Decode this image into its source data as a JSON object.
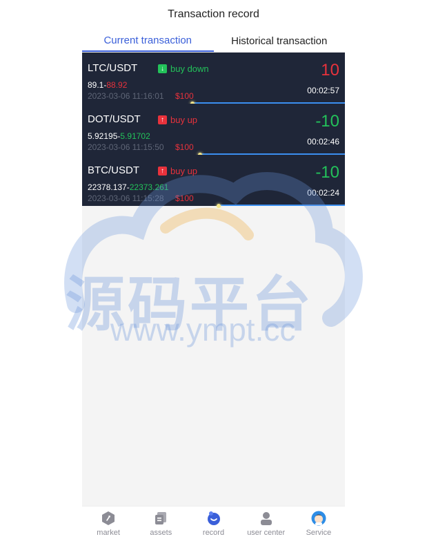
{
  "header": {
    "title": "Transaction record"
  },
  "tabs": [
    {
      "label": "Current transaction",
      "active": true
    },
    {
      "label": "Historical transaction",
      "active": false
    }
  ],
  "trades": [
    {
      "pair": "LTC/USDT",
      "direction": "buy down",
      "direction_type": "down",
      "open_price": "89.1",
      "separator": "-",
      "current_price": "88.92",
      "current_price_color": "red",
      "time": "2023-03-06 11:16:01",
      "amount": "$100",
      "profit": "10",
      "profit_color": "red",
      "countdown": "00:02:57",
      "progress": 0.58
    },
    {
      "pair": "DOT/USDT",
      "direction": "buy up",
      "direction_type": "up",
      "open_price": "5.92195",
      "separator": "-",
      "current_price": "5.91702",
      "current_price_color": "green",
      "time": "2023-03-06 11:15:50",
      "amount": "$100",
      "profit": "-10",
      "profit_color": "green",
      "countdown": "00:02:46",
      "progress": 0.55
    },
    {
      "pair": "BTC/USDT",
      "direction": "buy up",
      "direction_type": "up",
      "open_price": "22378.137",
      "separator": "-",
      "current_price": "22373.261",
      "current_price_color": "green",
      "time": "2023-03-06 11:15:28",
      "amount": "$100",
      "profit": "-10",
      "profit_color": "green",
      "countdown": "00:02:24",
      "progress": 0.48
    }
  ],
  "watermark": {
    "title": "源码平台",
    "url": "www.ympt.cc"
  },
  "tabbar": [
    {
      "label": "market",
      "icon": "market-icon"
    },
    {
      "label": "assets",
      "icon": "assets-icon"
    },
    {
      "label": "record",
      "icon": "record-icon",
      "active": true
    },
    {
      "label": "user center",
      "icon": "user-icon"
    },
    {
      "label": "Service",
      "icon": "service-avatar-icon"
    }
  ],
  "colors": {
    "accent": "#3a5fd9",
    "card_bg": "#1f2638",
    "red": "#e8323c",
    "green": "#23c25a",
    "progress": "#3b8ff0"
  }
}
